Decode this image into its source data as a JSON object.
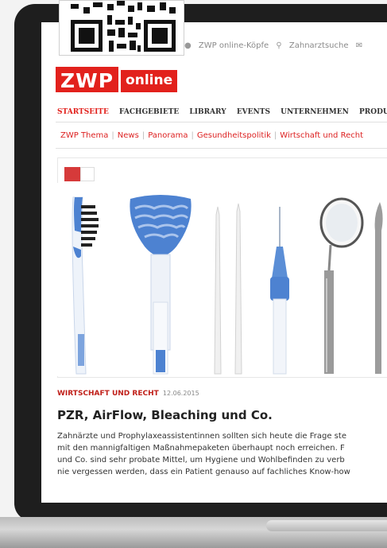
{
  "header": {
    "top_links": [
      "ZWP online-Köpfe",
      "Zahnarztsuche"
    ],
    "logo_left": "ZWP",
    "logo_right": "online"
  },
  "main_nav": [
    "STARTSEITE",
    "FACHGEBIETE",
    "LIBRARY",
    "EVENTS",
    "UNTERNEHMEN",
    "PRODUKTE"
  ],
  "sub_nav": [
    "ZWP Thema",
    "News",
    "Panorama",
    "Gesundheitspolitik",
    "Wirtschaft und Recht"
  ],
  "article": {
    "category": "WIRTSCHAFT UND RECHT",
    "date": "12.06.2015",
    "headline": "PZR, AirFlow, Bleaching und Co.",
    "body_lines": [
      "Zahnärzte und Prophylaxeassistentinnen sollten sich heute die Frage ste",
      "mit den mannigfaltigen Maßnahmepaketen überhaupt noch erreichen. F",
      "und Co. sind sehr probate Mittel, um Hygiene und Wohlbefinden zu verb",
      "nie vergessen werden, dass ein Patient genauso auf fachliches Know-how"
    ]
  },
  "colors": {
    "brand_red": "#e2211c",
    "tool_blue": "#4d82d1"
  }
}
